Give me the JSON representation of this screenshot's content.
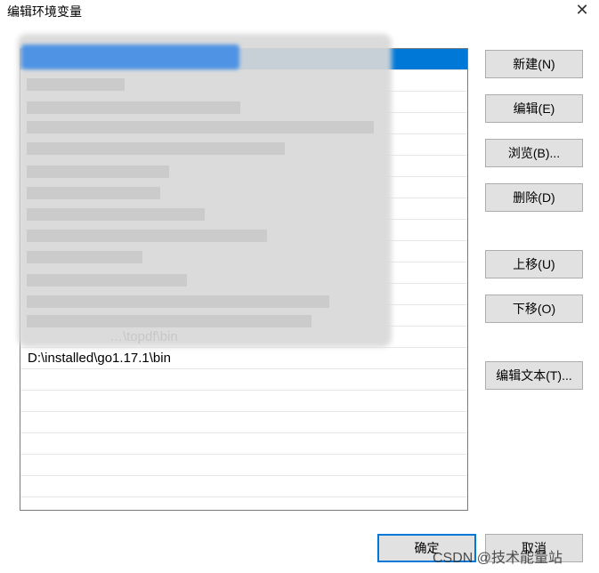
{
  "window": {
    "title": "编辑环境变量",
    "close_glyph": "✕"
  },
  "path_list": {
    "entries": [
      "",
      "",
      "",
      "",
      "",
      "",
      "",
      "",
      "",
      "",
      "",
      "",
      "",
      "",
      "…\\topdf\\bin",
      "D:\\installed\\go1.17.1\\bin",
      "",
      "",
      "",
      "",
      "",
      "",
      "",
      "",
      "",
      "",
      "",
      ""
    ]
  },
  "buttons": {
    "new": "新建(N)",
    "edit": "编辑(E)",
    "browse": "浏览(B)...",
    "delete": "删除(D)",
    "move_up": "上移(U)",
    "move_down": "下移(O)",
    "edit_text": "编辑文本(T)...",
    "ok": "确定",
    "cancel": "取消"
  },
  "watermark": "CSDN @技术能量站",
  "colors": {
    "selection": "#0078d7",
    "default_button_border": "#0078d7"
  }
}
